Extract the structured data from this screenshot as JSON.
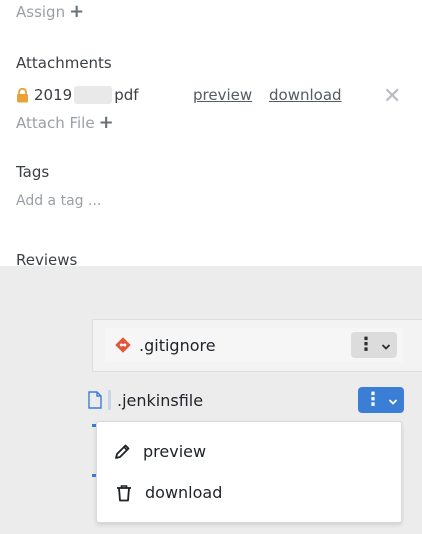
{
  "top": {
    "assign_label": "Assign",
    "plus_glyph": "+",
    "attachments": {
      "title": "Attachments",
      "file": {
        "lock_icon": "lock-icon",
        "name_prefix": "2019",
        "name_suffix": "pdf",
        "preview_label": "preview",
        "download_label": "download",
        "remove_glyph": "✕"
      },
      "attach_label": "Attach File"
    },
    "tags": {
      "title": "Tags",
      "placeholder": "Add a tag ..."
    },
    "reviews_title": "Reviews"
  },
  "files": {
    "items": [
      {
        "name": ".gitignore",
        "icon": "git-icon",
        "menu": "gray"
      },
      {
        "name": ".jenkinsfile",
        "icon": "file-icon",
        "menu": "blue"
      }
    ],
    "menu_glyph": "⋮",
    "chevron_glyph": "⌄",
    "dropdown": [
      {
        "label": "preview",
        "icon": "pencil-icon"
      },
      {
        "label": "download",
        "icon": "trash-icon"
      }
    ]
  },
  "colors": {
    "accent_blue": "#3a7fd5",
    "lock_orange": "#e8a23a",
    "git_red": "#e2573b",
    "bottom_bg": "#ececec"
  }
}
